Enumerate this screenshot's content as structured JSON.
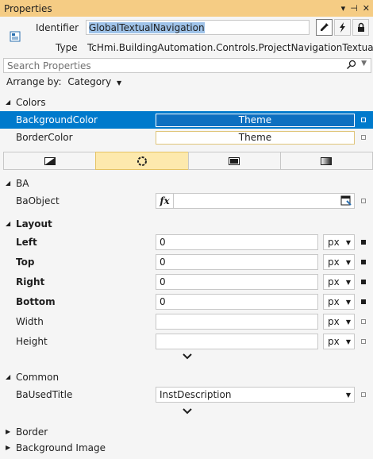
{
  "window": {
    "title": "Properties",
    "controls": [
      "▾",
      "⊣",
      "✕"
    ]
  },
  "identifier": {
    "label": "Identifier",
    "value": "GlobalTextualNavigation"
  },
  "type": {
    "label": "Type",
    "value": "TcHmi.BuildingAutomation.Controls.ProjectNavigationTextual"
  },
  "toolbar": {
    "icons": [
      "wrench-icon",
      "lightning-icon",
      "lock-icon"
    ]
  },
  "search": {
    "placeholder": "Search Properties"
  },
  "arrange": {
    "label": "Arrange by:",
    "value": "Category"
  },
  "colors": {
    "category": "Colors",
    "rows": [
      {
        "name": "BackgroundColor",
        "value": "Theme"
      },
      {
        "name": "BorderColor",
        "value": "Theme"
      }
    ]
  },
  "ba": {
    "category": "BA",
    "baobject": {
      "name": "BaObject",
      "fx": "fx",
      "value": ""
    }
  },
  "layout": {
    "category": "Layout",
    "rows": [
      {
        "name": "Left",
        "value": "0",
        "unit": "px"
      },
      {
        "name": "Top",
        "value": "0",
        "unit": "px"
      },
      {
        "name": "Right",
        "value": "0",
        "unit": "px"
      },
      {
        "name": "Bottom",
        "value": "0",
        "unit": "px"
      },
      {
        "name": "Width",
        "value": "",
        "unit": "px"
      },
      {
        "name": "Height",
        "value": "",
        "unit": "px"
      }
    ]
  },
  "common": {
    "category": "Common",
    "used_title": {
      "name": "BaUsedTitle",
      "value": "InstDescription"
    }
  },
  "border": {
    "category": "Border"
  },
  "background_image": {
    "category": "Background Image"
  },
  "colors_accent": {
    "title_bar": "#f5cc84",
    "selection": "#007acc",
    "active_tab": "#fde9ad"
  }
}
